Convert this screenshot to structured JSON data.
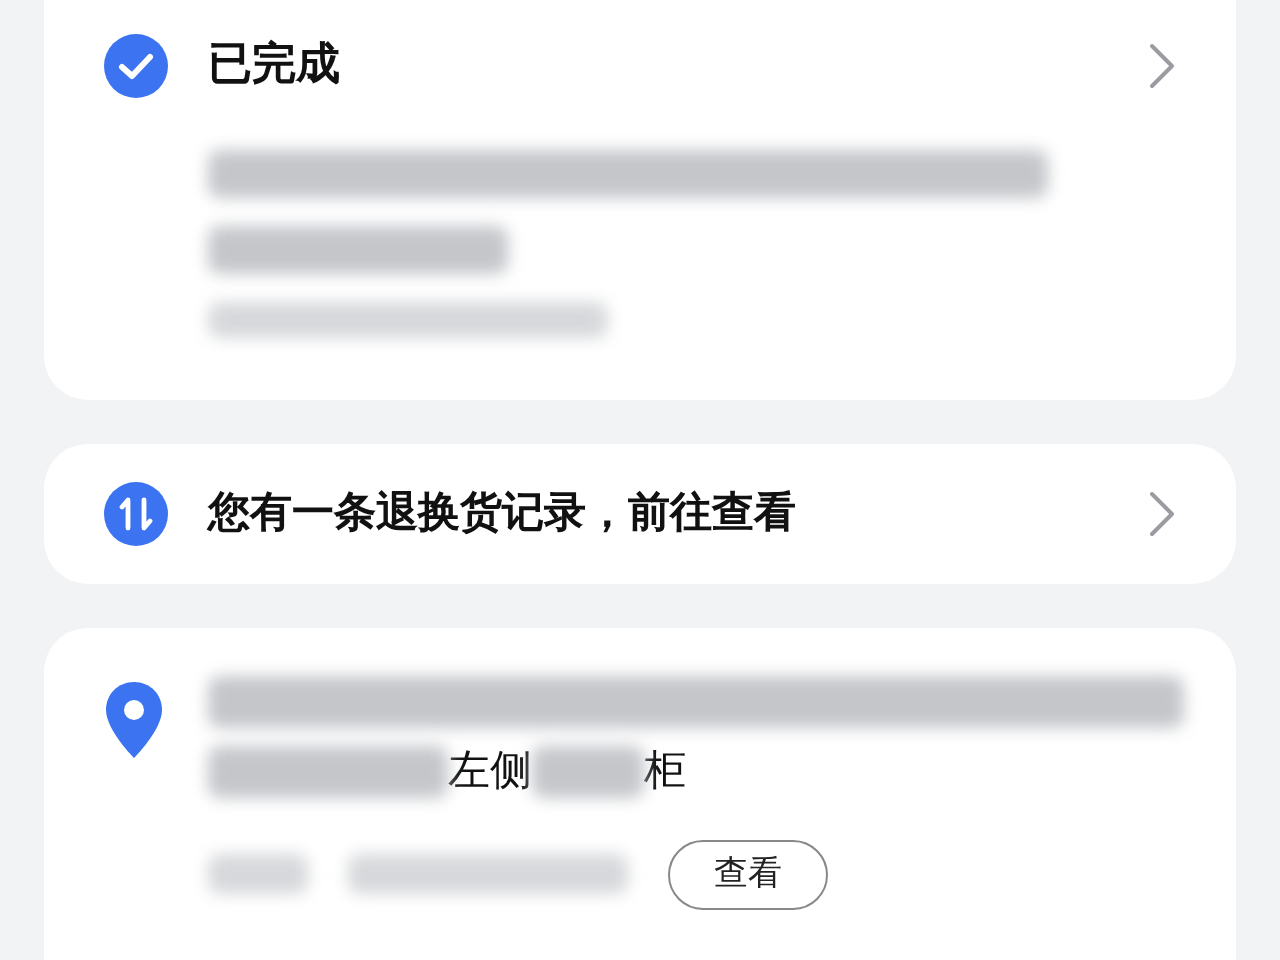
{
  "status_card": {
    "title": "已完成"
  },
  "return_card": {
    "text": "您有一条退换货记录，前往查看"
  },
  "address_card": {
    "address_parts": [
      "左侧",
      "柜"
    ],
    "view_button": "查看"
  }
}
